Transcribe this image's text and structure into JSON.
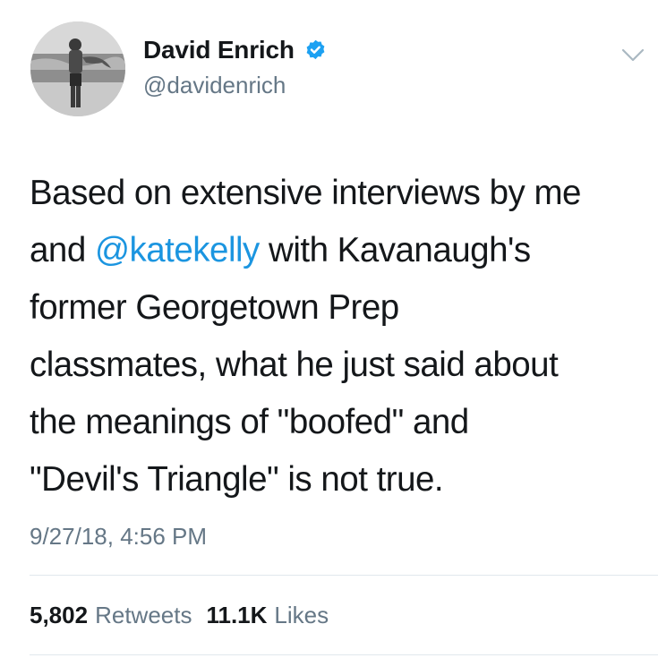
{
  "tweet": {
    "display_name": "David Enrich",
    "handle": "@davidenrich",
    "verified": true,
    "text_lines": [
      {
        "before": "Based on extensive interviews by me",
        "mention": "",
        "after": ""
      },
      {
        "before": "and ",
        "mention": "@katekelly",
        "after": " with Kavanaugh's"
      },
      {
        "before": "former Georgetown Prep",
        "mention": "",
        "after": ""
      },
      {
        "before": "classmates, what he just said about",
        "mention": "",
        "after": ""
      },
      {
        "before": "the meanings of \"boofed\" and",
        "mention": "",
        "after": ""
      },
      {
        "before": "\"Devil's Triangle\" is not true.",
        "mention": "",
        "after": ""
      }
    ],
    "timestamp": "9/27/18, 4:56 PM",
    "stats": {
      "retweets_count": "5,802",
      "retweets_label": "Retweets",
      "likes_count": "11.1K",
      "likes_label": "Likes"
    }
  },
  "colors": {
    "link": "#1b95e0",
    "secondary_text": "#657786",
    "verified_badge": "#1da1f2",
    "divider": "#e1e8ed"
  },
  "icons": {
    "verified": "verified-badge-icon",
    "menu": "chevron-down-icon"
  }
}
